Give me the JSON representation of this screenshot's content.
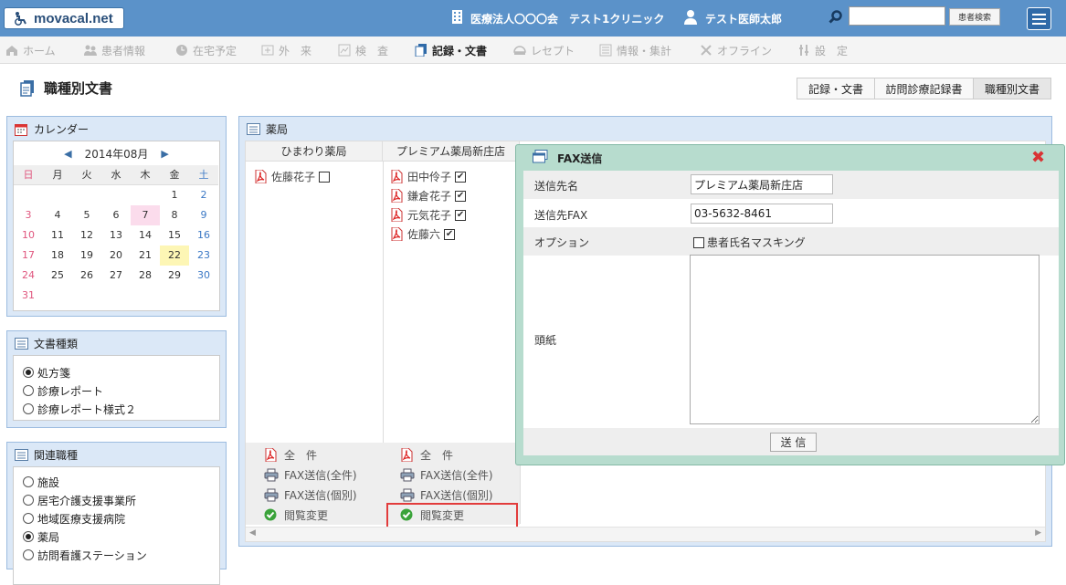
{
  "header": {
    "logo": "movacal.net",
    "org": "医療法人〇〇〇会　テスト1クリニック",
    "user": "テスト医師太郎",
    "search_placeholder": "",
    "search_button": "患者検索"
  },
  "nav": [
    {
      "label": "ホーム",
      "icon": "home-icon"
    },
    {
      "label": "患者情報",
      "icon": "patients-icon"
    },
    {
      "label": "在宅予定",
      "icon": "clock-icon"
    },
    {
      "label": "外　来",
      "icon": "outpatient-icon"
    },
    {
      "label": "検　査",
      "icon": "exam-icon"
    },
    {
      "label": "記録・文書",
      "icon": "document-icon",
      "active": true
    },
    {
      "label": "レセプト",
      "icon": "receipt-icon"
    },
    {
      "label": "情報・集計",
      "icon": "stats-icon"
    },
    {
      "label": "オフライン",
      "icon": "offline-icon"
    },
    {
      "label": "設　定",
      "icon": "settings-icon"
    }
  ],
  "page": {
    "title": "職種別文書",
    "tabs": [
      "記録・文書",
      "訪問診療記録書",
      "職種別文書"
    ]
  },
  "calendar": {
    "title": "カレンダー",
    "month": "2014年08月",
    "weekdays": [
      "日",
      "月",
      "火",
      "水",
      "木",
      "金",
      "土"
    ],
    "weeks": [
      [
        "",
        "",
        "",
        "",
        "",
        "1",
        "2"
      ],
      [
        "3",
        "4",
        "5",
        "6",
        "7",
        "8",
        "9"
      ],
      [
        "10",
        "11",
        "12",
        "13",
        "14",
        "15",
        "16"
      ],
      [
        "17",
        "18",
        "19",
        "20",
        "21",
        "22",
        "23"
      ],
      [
        "24",
        "25",
        "26",
        "27",
        "28",
        "29",
        "30"
      ],
      [
        "31",
        "",
        "",
        "",
        "",
        "",
        ""
      ]
    ],
    "highlight_today": "22",
    "highlight_pink": "7"
  },
  "doc_types": {
    "title": "文書種類",
    "options": [
      "処方箋",
      "診療レポート",
      "診療レポート様式２"
    ],
    "selected": 0
  },
  "related": {
    "title": "関連職種",
    "options": [
      "施設",
      "居宅介護支援事業所",
      "地域医療支援病院",
      "薬局",
      "訪問看護ステーション"
    ],
    "selected": 3
  },
  "pharmacy": {
    "title": "薬局",
    "columns": [
      {
        "name": "ひまわり薬局",
        "patients": [
          {
            "name": "佐藤花子",
            "checked": false
          }
        ]
      },
      {
        "name": "プレミアム薬局新庄店",
        "patients": [
          {
            "name": "田中伶子",
            "checked": true
          },
          {
            "name": "鎌倉花子",
            "checked": true
          },
          {
            "name": "元気花子",
            "checked": true
          },
          {
            "name": "佐藤六",
            "checked": true
          }
        ]
      }
    ],
    "actions": {
      "all": "全　件",
      "fax_all": "FAX送信(全件)",
      "fax_each": "FAX送信(個別)",
      "view_change": "閲覧変更"
    }
  },
  "fax_modal": {
    "title": "FAX送信",
    "dest_name_label": "送信先名",
    "dest_name_value": "プレミアム薬局新庄店",
    "dest_fax_label": "送信先FAX",
    "dest_fax_value": "03-5632-8461",
    "option_label": "オプション",
    "option_mask": "患者氏名マスキング",
    "cover_label": "頭紙",
    "cover_value": "",
    "send_button": "送 信"
  },
  "colors": {
    "header": "#5b92c9",
    "highlight_box": "#e23c3c",
    "modal_bg": "#b7dcce"
  }
}
